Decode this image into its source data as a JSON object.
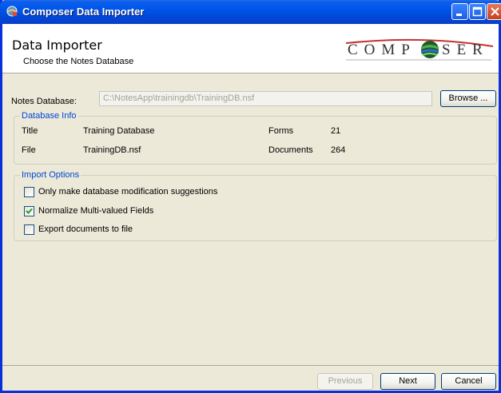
{
  "window": {
    "title": "Composer Data Importer"
  },
  "header": {
    "title": "Data Importer",
    "subtitle": "Choose the Notes Database",
    "logo": {
      "left": "COMP",
      "right": "SER",
      "full": "COMPOSER"
    }
  },
  "notes_database": {
    "label": "Notes Database:",
    "value": "C:\\NotesApp\\trainingdb\\TrainingDB.nsf",
    "browse_label": "Browse ..."
  },
  "database_info": {
    "legend": "Database Info",
    "title_label": "Title",
    "title_value": "Training Database",
    "file_label": "File",
    "file_value": "TrainingDB.nsf",
    "forms_label": "Forms",
    "forms_value": "21",
    "documents_label": "Documents",
    "documents_value": "264"
  },
  "import_options": {
    "legend": "Import Options",
    "options": [
      {
        "label": "Only make database modification suggestions",
        "checked": false
      },
      {
        "label": "Normalize Multi-valued Fields",
        "checked": true
      },
      {
        "label": "Export documents to file",
        "checked": false
      }
    ]
  },
  "footer": {
    "previous_label": "Previous",
    "next_label": "Next",
    "cancel_label": "Cancel"
  },
  "colors": {
    "titlebar": "#0055e8",
    "group_title": "#0046d5",
    "window_bg": "#ece9d8",
    "check": "#21a121"
  }
}
